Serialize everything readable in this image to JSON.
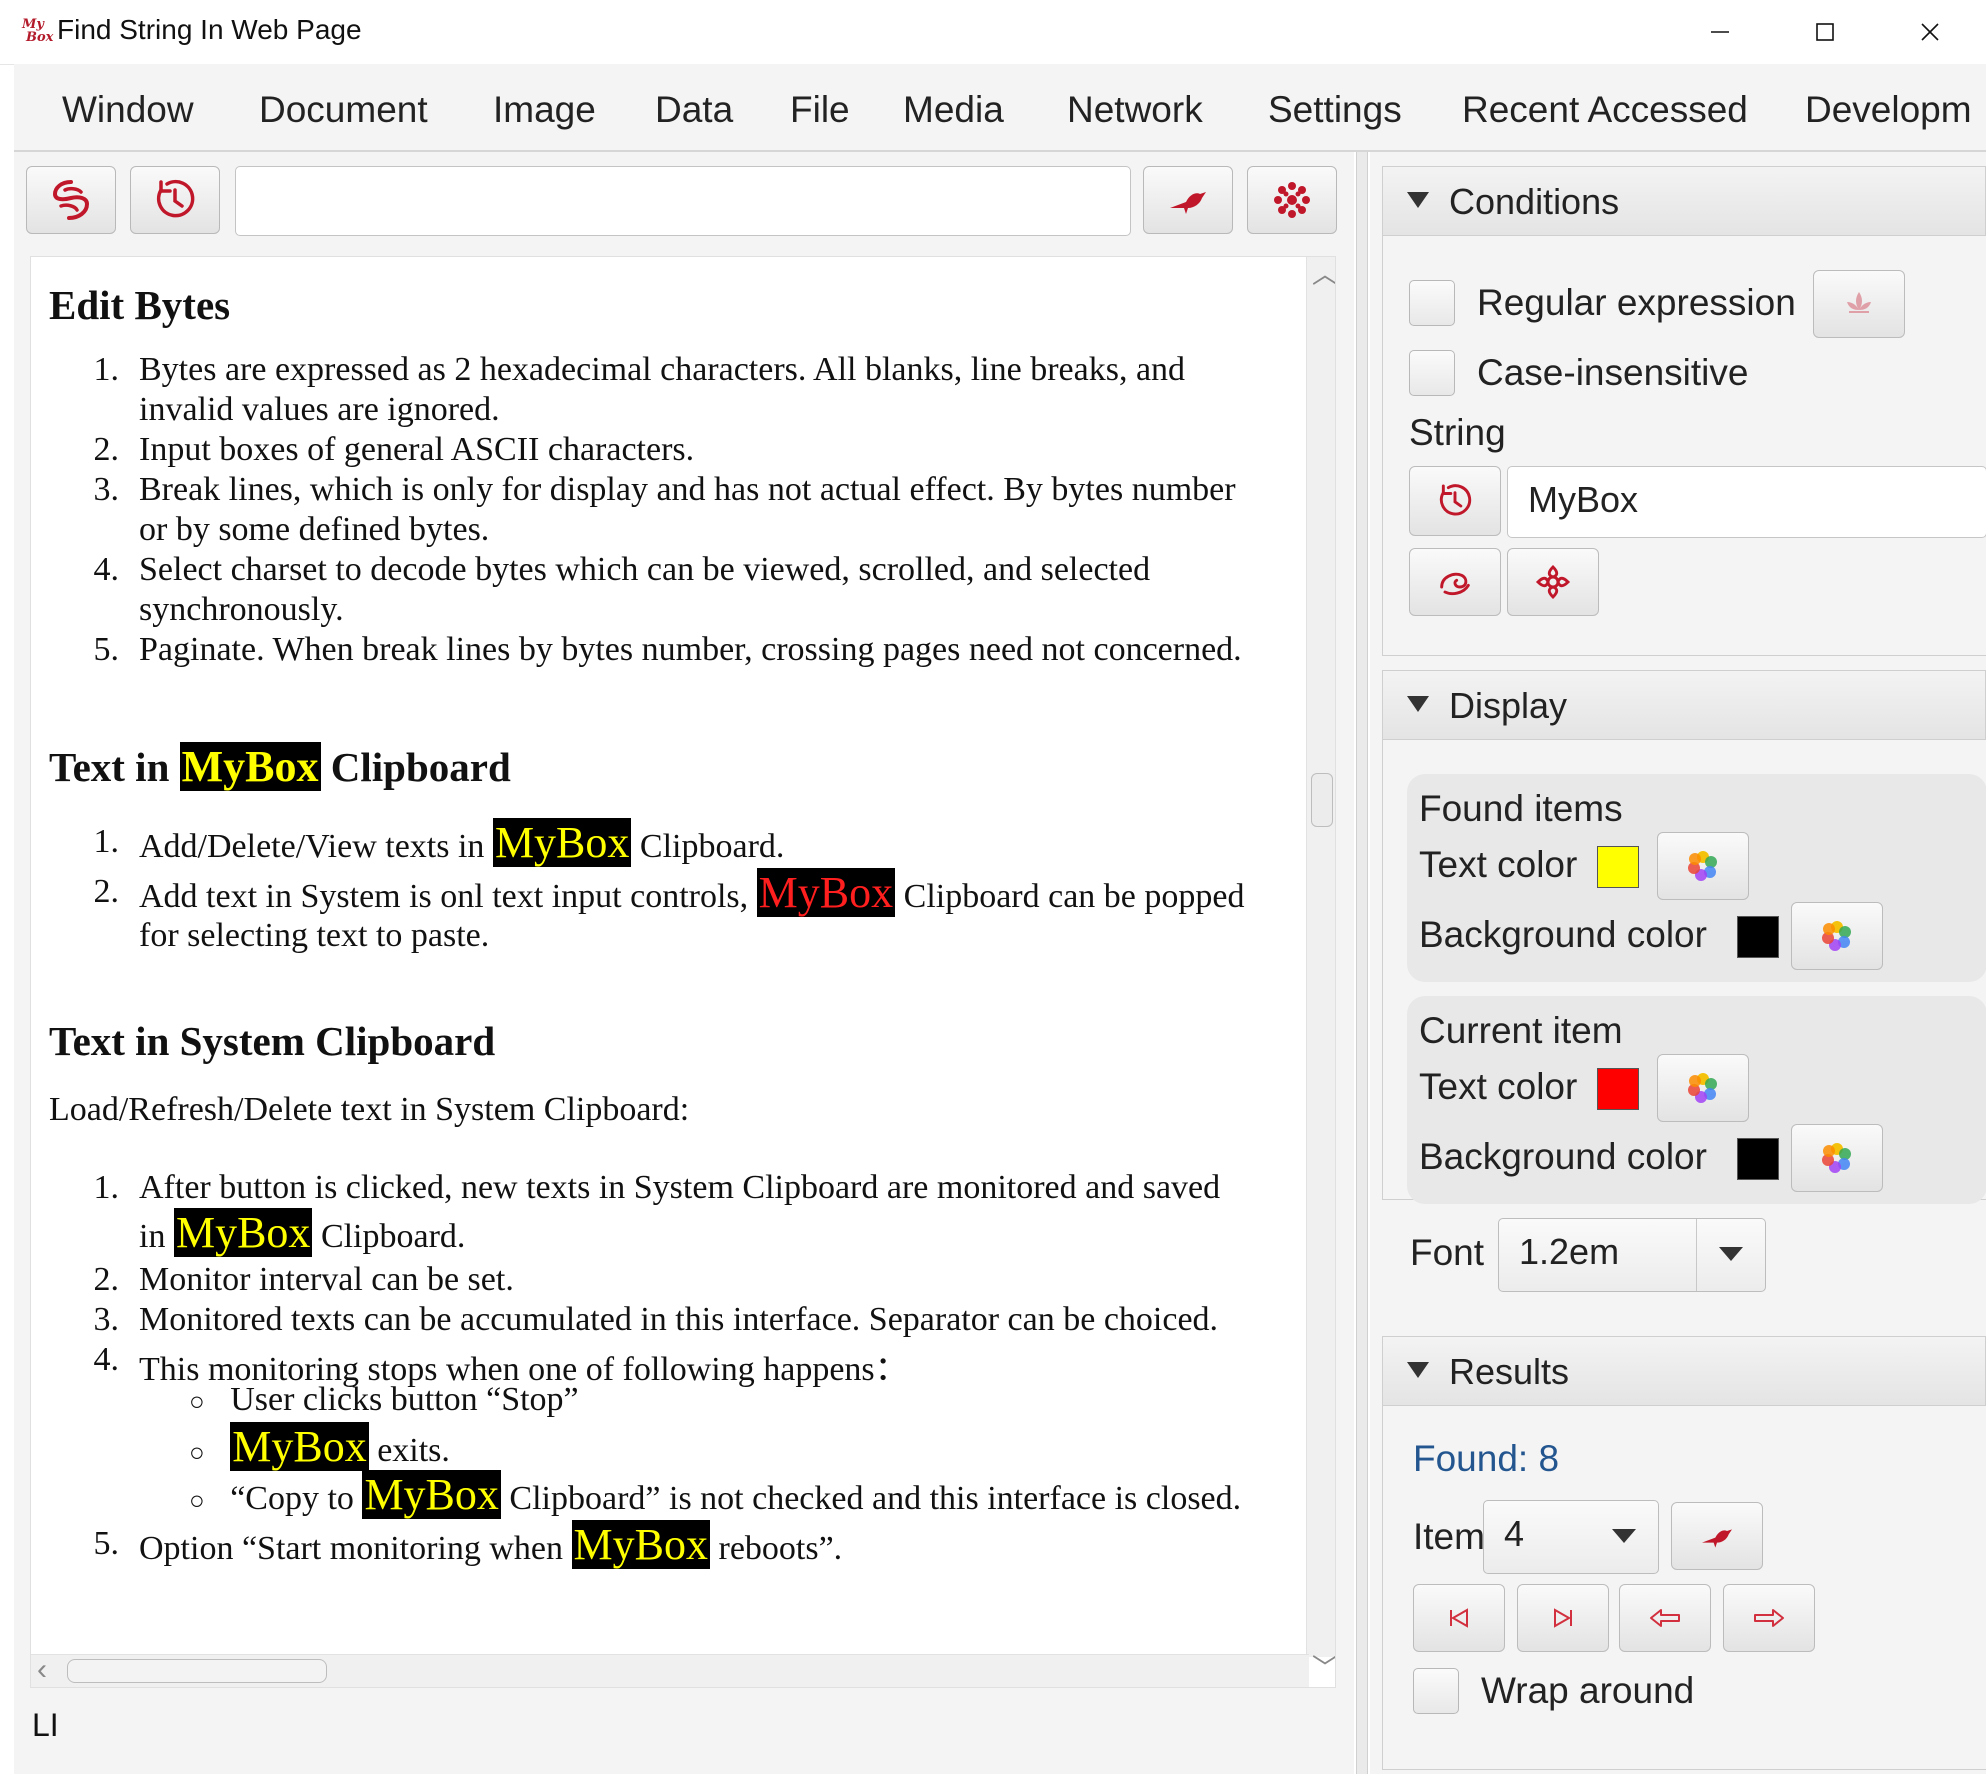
{
  "window": {
    "title": "Find String In Web Page",
    "logo_text": [
      "My",
      "Box"
    ]
  },
  "menu": [
    "Window",
    "Document",
    "Image",
    "Data",
    "File",
    "Media",
    "Network",
    "Settings",
    "Recent Accessed",
    "Developm"
  ],
  "toolbar": {
    "address_value": "",
    "icons": [
      "web-browse-icon",
      "history-clock-icon",
      "go-bird-icon",
      "flower-options-icon"
    ]
  },
  "document": {
    "sections": [
      {
        "heading": "Edit Bytes",
        "items": [
          [
            "Bytes are expressed as 2 hexadecimal characters. All blanks, line breaks, and",
            "invalid values are ignored."
          ],
          [
            "Input boxes of general ASCII characters."
          ],
          [
            "Break lines, which is only for display and has not actual effect. By bytes number",
            "or by some defined bytes."
          ],
          [
            "Select charset to decode bytes which can be viewed, scrolled, and selected",
            "synchronously."
          ],
          [
            "Paginate. When break lines by bytes number, crossing pages need not concerned."
          ]
        ]
      },
      {
        "heading_before": "Text in",
        "heading_mark": "MyBox",
        "heading_after": "Clipboard",
        "items": [
          {
            "before": "Add/Delete/View texts in",
            "mark": "MyBox",
            "after": "Clipboard."
          },
          {
            "before": "Add text in System is onl text input controls,",
            "mark": "MyBox",
            "after": "Clipboard can be popped",
            "cont": "for selecting text to paste."
          }
        ]
      },
      {
        "heading": "Text in System Clipboard",
        "intro": "Load/Refresh/Delete text in System Clipboard:",
        "items": [
          {
            "line1": "After button is clicked, new texts in System Clipboard are monitored and saved",
            "before2": "in",
            "mark": "MyBox",
            "after2": "Clipboard."
          },
          {
            "text": "Monitor interval can be set."
          },
          {
            "text": "Monitored texts can be accumulated in this interface. Separator can be choiced."
          },
          {
            "text": "This monitoring stops when one of following happens："
          }
        ],
        "subitems": [
          {
            "before": "User clicks button “Stop”"
          },
          {
            "mark": "MyBox",
            "after": "exits."
          },
          {
            "before": "“Copy to",
            "mark": "MyBox",
            "after": "Clipboard” is not checked and this interface is closed."
          }
        ],
        "last": {
          "before": "Option “Start monitoring when",
          "mark": "MyBox",
          "after": "reboots”."
        }
      }
    ],
    "numbers": [
      "1.",
      "2.",
      "3.",
      "4.",
      "5."
    ]
  },
  "status": "LI",
  "conditions": {
    "header": "Conditions",
    "regex_label": "Regular expression",
    "regex_checked": false,
    "case_label": "Case-insensitive",
    "case_checked": false,
    "string_label": "String",
    "string_value": "MyBox"
  },
  "display": {
    "header": "Display",
    "found_title": "Found items",
    "found_text_label": "Text color",
    "found_text_color": "#ffff00",
    "found_bg_label": "Background color",
    "found_bg_color": "#000000",
    "current_title": "Current item",
    "current_text_label": "Text color",
    "current_text_color": "#ff0000",
    "current_bg_label": "Background color",
    "current_bg_color": "#000000",
    "font_label": "Font",
    "font_value": "1.2em"
  },
  "results": {
    "header": "Results",
    "found": "Found: 8",
    "item_label": "Item",
    "item_value": "4",
    "wrap_label": "Wrap around",
    "wrap_checked": false
  },
  "colors": {
    "accent_icon": "#c0182a",
    "link_blue": "#23558f"
  }
}
